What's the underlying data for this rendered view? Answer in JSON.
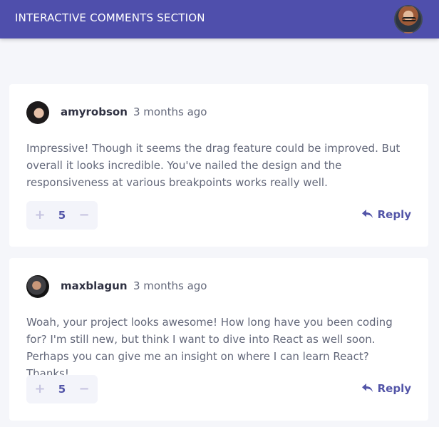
{
  "header": {
    "title": "INTERACTIVE COMMENTS SECTION",
    "avatar_icon": "user-avatar-icon",
    "background_color": "#4f4fac"
  },
  "comments": [
    {
      "username": "amyrobson",
      "timestamp": "3 months ago",
      "text": "Impressive! Though it seems the drag feature could be improved. But overall it looks incredible. You've nailed the design and the responsiveness at various breakpoints works really well.",
      "score": "5",
      "reply_label": "Reply",
      "upvote_label": "+",
      "downvote_label": "−",
      "avatar_icon": "amy-avatar-icon"
    },
    {
      "username": "maxblagun",
      "timestamp": "3 months ago",
      "text": "Woah, your project looks awesome! How long have you been coding for? I'm still new, but think I want to dive into React as well soon. Perhaps you can give me an insight on where I can learn React? Thanks!",
      "score": "5",
      "reply_label": "Reply",
      "upvote_label": "+",
      "downvote_label": "−",
      "avatar_icon": "max-avatar-icon"
    }
  ],
  "colors": {
    "accent": "#5355a8",
    "text": "#63687a",
    "heading": "#2f3142",
    "background": "#f5f6fa"
  }
}
